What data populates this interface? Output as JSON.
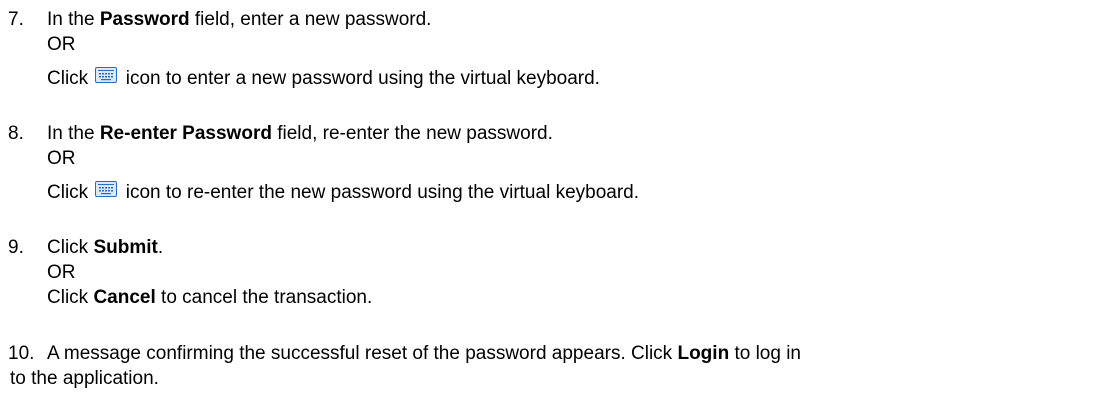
{
  "steps": [
    {
      "number": "7.",
      "line1": {
        "before": "In the ",
        "bold": "Password",
        "after": " field, enter a new password."
      },
      "or": "OR",
      "line3": {
        "before": "Click ",
        "icon": "virtual-keyboard-icon",
        "after": " icon to enter a new password using the virtual keyboard."
      }
    },
    {
      "number": "8.",
      "line1": {
        "before": "In the ",
        "bold": "Re-enter Password",
        "after": " field, re-enter the new password."
      },
      "or": "OR",
      "line3": {
        "before": "Click ",
        "icon": "virtual-keyboard-icon",
        "after": " icon to re-enter the new password using the virtual keyboard."
      }
    },
    {
      "number": "9.",
      "line1": {
        "before": "Click ",
        "bold": "Submit",
        "after": "."
      },
      "or": "OR",
      "line3": {
        "before": "Click ",
        "bold": "Cancel",
        "after": " to cancel the transaction."
      }
    },
    {
      "number": "10.",
      "line1": {
        "before": "A message confirming the successful reset of the password appears. Click ",
        "bold": "Login",
        "after": " to log in"
      },
      "line2": "to the application."
    }
  ],
  "colors": {
    "text": "#000000",
    "icon_border": "#2a6cc4",
    "icon_fill": "#d9e9fb"
  }
}
